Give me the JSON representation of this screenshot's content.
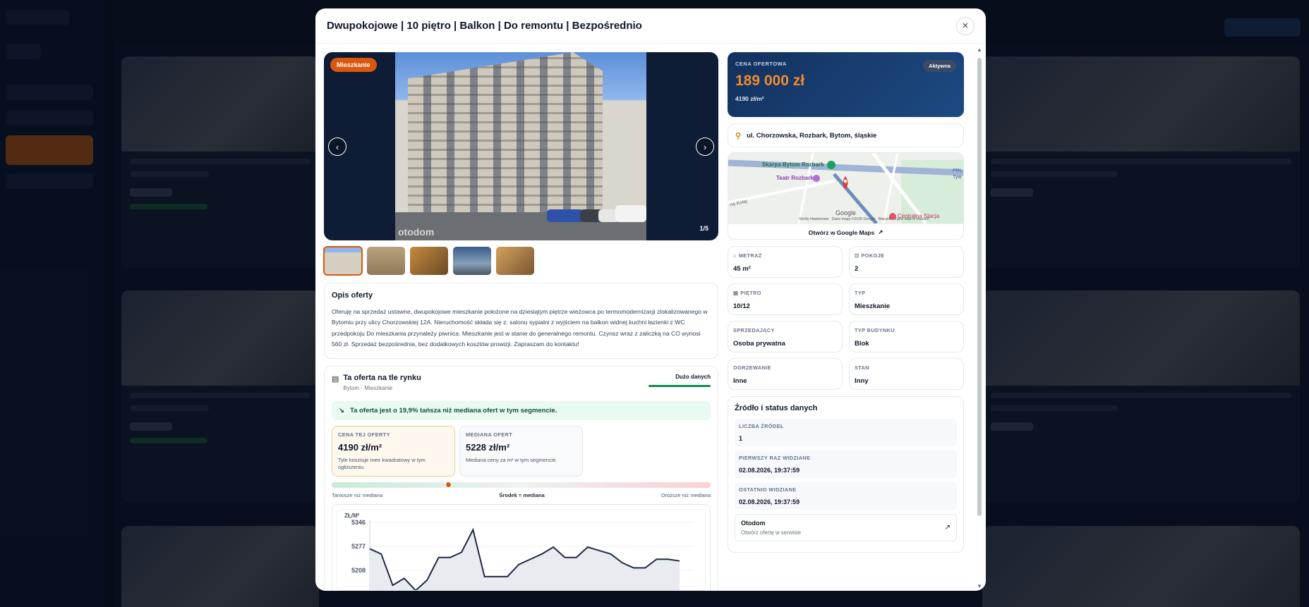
{
  "modal": {
    "title": "Dwupokojowe | 10 piętro | Balkon | Do remontu | Bezpośrednio",
    "close_icon": "×"
  },
  "gallery": {
    "type_badge": "Mieszkanie",
    "counter": "1/5",
    "watermark": "otodom",
    "prev_icon": "‹",
    "next_icon": "›"
  },
  "description": {
    "title": "Opis oferty",
    "text": "Oferuję na sprzedaż ustawne, dwupokojowe mieszkanie położone na dziesiątym piętrze wieżowca po termomodernizacji zlokalizowanego w Bytomiu przy ulicy Chorzowskiej 12A. Nieruchomość składa się z: salonu sypialni z wyjściem na balkon widnej kuchni łazienki z WC przedpokoju Do mieszkania przynależy piwnica. Mieszkanie jest w stanie do generalnego remontu. Czynsz wraz z zaliczką na CO wynosi 560 zł. Sprzedaż bezpośrednia, bez dodatkowych kosztów prowizji. Zapraszam do kontaktu!"
  },
  "market": {
    "title": "Ta oferta na tle rynku",
    "subtitle": "Bytom · Mieszkanie",
    "data_amount": "Dużo danych",
    "highlight": "Ta oferta jest o 19,9% tańsza niż mediana ofert w tym segmencie.",
    "this_offer": {
      "label": "CENA TEJ OFERTY",
      "value": "4190 zł/m²",
      "hint": "Tyle kosztuje metr kwadratowy w tym ogłoszeniu."
    },
    "median": {
      "label": "MEDIANA OFERT",
      "value": "5228 zł/m²",
      "hint": "Mediana ceny za m² w tym segmencie."
    },
    "scale_position": 0.3,
    "scale_left": "Taniosze niż mediana",
    "scale_mid": "Środek = mediana",
    "scale_right": "Droższe niż mediana"
  },
  "chart_data": {
    "type": "line",
    "ylabel": "ZŁ/M²",
    "yticks": [
      5346,
      5277,
      5208
    ],
    "values": [
      5270,
      5255,
      5165,
      5185,
      5150,
      5180,
      5245,
      5245,
      5260,
      5325,
      5190,
      5190,
      5190,
      5225,
      5240,
      5255,
      5275,
      5245,
      5245,
      5275,
      5265,
      5255,
      5230,
      5215,
      5215,
      5240,
      5240,
      5235
    ]
  },
  "price": {
    "label": "CENA OFERTOWA",
    "value": "189 000 zł",
    "per_sqm": "4190 zł/m²",
    "status": "Aktywna"
  },
  "address": "ul. Chorzowska, Rozbark, Bytom, śląskie",
  "map": {
    "labels": {
      "skarpa": "Skarpa Bytom Rozbark",
      "teatr": "Teatr Rozbark",
      "stacja": "Centralna Stacja",
      "prl": "PRL",
      "tyw": "Tyw",
      "kolej": "na Kolej",
      "google": "Google",
      "footer": "Skróty klawiszowe   Dane mapy ©2026 Google   Warunki   Zgłoś błąd w mapach"
    },
    "open_link": "Otwórz w Google Maps"
  },
  "facts": [
    {
      "label": "METRAŻ",
      "value": "45 m²",
      "icon": "⌂"
    },
    {
      "label": "POKOJE",
      "value": "2",
      "icon": "⊡"
    },
    {
      "label": "PIĘTRO",
      "value": "10/12",
      "icon": "▤"
    },
    {
      "label": "TYP",
      "value": "Mieszkanie",
      "icon": ""
    },
    {
      "label": "SPRZEDAJĄCY",
      "value": "Osoba prywatna",
      "icon": ""
    },
    {
      "label": "TYP BUDYNKU",
      "value": "Blok",
      "icon": ""
    },
    {
      "label": "OGRZEWANIE",
      "value": "Inne",
      "icon": ""
    },
    {
      "label": "STAN",
      "value": "Inny",
      "icon": ""
    }
  ],
  "source": {
    "title": "Źródło i status danych",
    "rows": [
      {
        "label": "LICZBA ŹRÓDEŁ",
        "value": "1"
      },
      {
        "label": "PIERWSZY RAZ WIDZIANE",
        "value": "02.08.2026, 19:37:59"
      },
      {
        "label": "OSTATNIO WIDZIANE",
        "value": "02.08.2026, 19:37:59"
      }
    ],
    "link_name": "Otodom",
    "link_desc": "Otwórz ofertę w serwisie"
  }
}
